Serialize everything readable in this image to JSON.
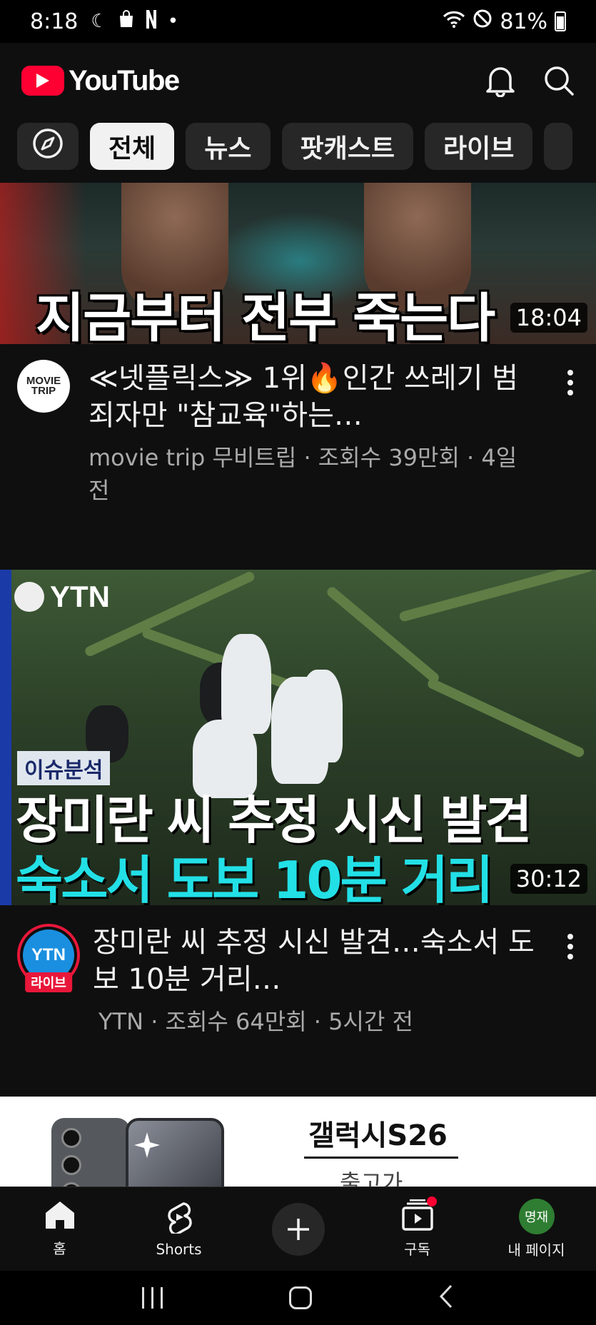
{
  "status_bar": {
    "time": "8:18",
    "battery": "81%"
  },
  "header": {
    "logo_text": "YouTube"
  },
  "chips": [
    "전체",
    "뉴스",
    "팟캐스트",
    "라이브"
  ],
  "videos": [
    {
      "thumbnail_caption": "지금부터 전부 죽는다",
      "duration": "18:04",
      "channel_avatar_text": "MOVIE TRIP",
      "title": "≪넷플릭스≫ 1위🔥인간 쓰레기 범죄자만 \"참교육\"하는…",
      "meta": "movie trip 무비트립 · 조회수 39만회 · 4일 전"
    },
    {
      "channel_logo": "YTN",
      "badge": "이슈분석",
      "thumbnail_line1": "장미란 씨 추정 시신 발견",
      "thumbnail_line2": "숙소서 도보 10분 거리",
      "duration": "30:12",
      "channel_avatar_text": "YTN",
      "live_badge": "라이브",
      "title": "장미란 씨 추정 시신 발견…숙소서 도보 10분 거리…",
      "meta": "YTN · 조회수 64만회 · 5시간 전"
    }
  ],
  "ad": {
    "title": "갤럭시S26",
    "subtitle": "출고가"
  },
  "bottom_nav": {
    "home": "홈",
    "shorts": "Shorts",
    "subscriptions": "구독",
    "me": "내 페이지",
    "me_avatar": "명재"
  },
  "colors": {
    "background": "#0f0f0f",
    "accent": "#ff0033",
    "chip": "#272727",
    "secondary_text": "#aaaaaa"
  }
}
